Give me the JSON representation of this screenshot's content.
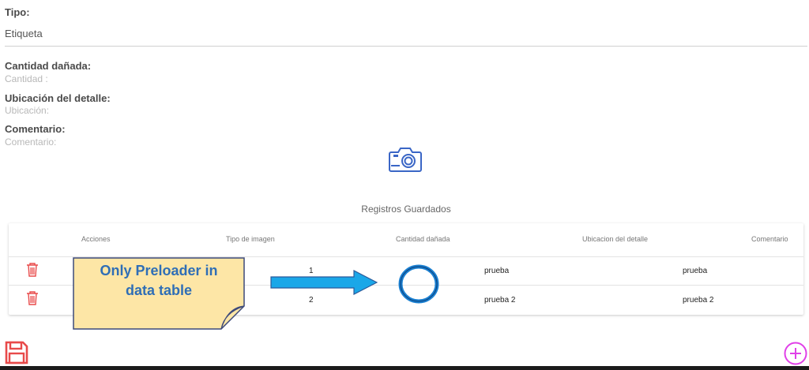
{
  "form": {
    "tipo_label": "Tipo:",
    "tipo_value": "Etiqueta",
    "cantidad_label": "Cantidad dañada:",
    "cantidad_placeholder": "Cantidad :",
    "ubicacion_label": "Ubicación del detalle:",
    "ubicacion_placeholder": "Ubicación:",
    "comentario_label": "Comentario:",
    "comentario_placeholder": "Comentario:"
  },
  "table": {
    "title": "Registros Guardados",
    "headers": [
      "Acciones",
      "Tipo de imagen",
      "Cantidad dañada",
      "Ubicacion del detalle",
      "Comentario"
    ],
    "rows": [
      {
        "tipo": "1",
        "ubicacion": "prueba",
        "comentario": "prueba"
      },
      {
        "tipo": "2",
        "ubicacion": "prueba 2",
        "comentario": "prueba 2"
      }
    ]
  },
  "annotation": {
    "line1": "Only Preloader in",
    "line2": "data table"
  },
  "colors": {
    "accent_icon": "#3a66c6",
    "delete_red": "#e84a4a",
    "add_magenta": "#e040e8",
    "callout_fill": "#fde6a6",
    "callout_text": "#2f6eb6",
    "arrow_fill": "#1aa7e8",
    "preloader_blue": "#1a7fd0"
  },
  "icons": {
    "camera": "camera-icon",
    "trash": "trash-icon",
    "save": "floppy-disk-icon",
    "add": "plus-circle-icon"
  }
}
